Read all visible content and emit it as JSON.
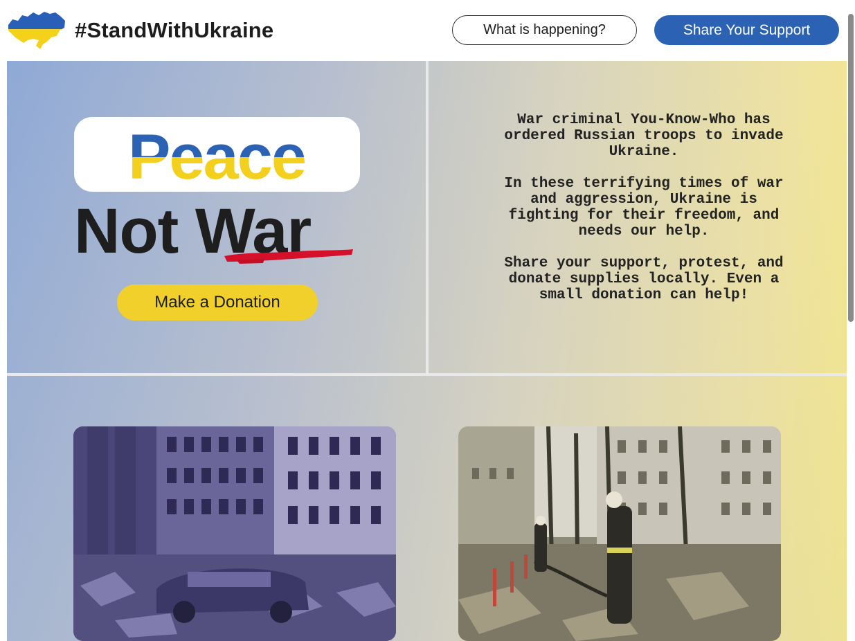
{
  "header": {
    "title": "#StandWithUkraine",
    "whats_happening_label": "What is happening?",
    "share_support_label": "Share Your Support",
    "logo_icon": "ukraine-map-flag-icon"
  },
  "hero": {
    "peace_word": "Peace",
    "not_war": "Not War",
    "donate_label": "Make a Donation"
  },
  "message": {
    "paragraphs": [
      "War criminal You-Know-Who has ordered Russian troops to invade Ukraine.",
      "In these terrifying times of war and aggression, Ukraine is fighting for their freedom, and needs our help.",
      "Share your support, protest, and donate supplies locally. Even a small donation can help!"
    ]
  },
  "photos": [
    {
      "alt": "destroyed-buildings-photo"
    },
    {
      "alt": "firefighters-rubble-photo"
    }
  ],
  "colors": {
    "ukraine_blue": "#2c62b3",
    "ukraine_yellow": "#f1d02c",
    "strike_red": "#d4102a"
  }
}
